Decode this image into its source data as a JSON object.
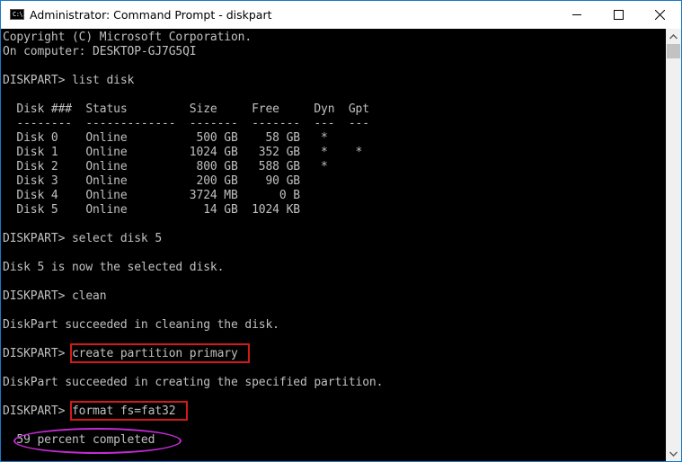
{
  "window": {
    "title": "Administrator: Command Prompt - diskpart",
    "icon_label": "C:\\.",
    "controls": [
      "minimize",
      "maximize",
      "close"
    ]
  },
  "console": {
    "lines": [
      "Copyright (C) Microsoft Corporation.",
      "On computer: DESKTOP-GJ7G5QI",
      "",
      "DISKPART> list disk",
      "",
      "  Disk ###  Status         Size     Free     Dyn  Gpt",
      "  --------  -------------  -------  -------  ---  ---",
      "  Disk 0    Online          500 GB    58 GB   *",
      "  Disk 1    Online         1024 GB   352 GB   *    *",
      "  Disk 2    Online          800 GB   588 GB   *",
      "  Disk 3    Online          200 GB    90 GB",
      "  Disk 4    Online         3724 MB      0 B",
      "  Disk 5    Online           14 GB  1024 KB",
      "",
      "DISKPART> select disk 5",
      "",
      "Disk 5 is now the selected disk.",
      "",
      "DISKPART> clean",
      "",
      "DiskPart succeeded in cleaning the disk.",
      "",
      "DISKPART> create partition primary",
      "",
      "DiskPart succeeded in creating the specified partition.",
      "",
      "DISKPART> format fs=fat32",
      "",
      "  59 percent completed"
    ],
    "disk_table": {
      "headers": [
        "Disk ###",
        "Status",
        "Size",
        "Free",
        "Dyn",
        "Gpt"
      ],
      "rows": [
        [
          "Disk 0",
          "Online",
          "500 GB",
          "58 GB",
          "*",
          ""
        ],
        [
          "Disk 1",
          "Online",
          "1024 GB",
          "352 GB",
          "*",
          "*"
        ],
        [
          "Disk 2",
          "Online",
          "800 GB",
          "588 GB",
          "*",
          ""
        ],
        [
          "Disk 3",
          "Online",
          "200 GB",
          "90 GB",
          "",
          ""
        ],
        [
          "Disk 4",
          "Online",
          "3724 MB",
          "0 B",
          "",
          ""
        ],
        [
          "Disk 5",
          "Online",
          "14 GB",
          "1024 KB",
          "",
          ""
        ]
      ]
    },
    "highlighted_commands": [
      "create partition primary",
      "format fs=fat32"
    ],
    "highlighted_status": "59 percent completed",
    "format_progress_percent": 59
  },
  "colors": {
    "console_bg": "#000000",
    "console_fg": "#c0c0c0",
    "highlight_box": "#d11a1a",
    "highlight_ellipse": "#c72bd6",
    "window_border": "#1979ca"
  }
}
